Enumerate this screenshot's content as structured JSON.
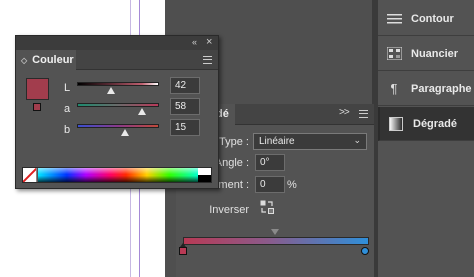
{
  "dock": {
    "items": [
      {
        "label": "Contour",
        "icon": "stroke-lines-icon"
      },
      {
        "label": "Nuancier",
        "icon": "swatches-grid-icon"
      },
      {
        "label": "Paragraphe",
        "icon": "pilcrow-icon",
        "glyph": "¶"
      },
      {
        "label": "Dégradé",
        "icon": "gradient-square-icon",
        "active": true
      }
    ]
  },
  "gradient_panel": {
    "tab_label_partial": "dé",
    "type_label": "Type :",
    "type_value": "Linéaire",
    "angle_label": "Angle :",
    "angle_value": "0°",
    "location_label_partial": "cement :",
    "location_value": "0",
    "location_unit": "%",
    "reverse_label": "Inverser",
    "start_color": "#b83a55",
    "end_color": "#2f8fd9"
  },
  "color_panel": {
    "title": "Couleur",
    "fill_color": "#a23d4d",
    "channels": [
      {
        "label": "L",
        "value": "42",
        "level": 0.42
      },
      {
        "label": "a",
        "value": "58",
        "level": 0.79
      },
      {
        "label": "b",
        "value": "15",
        "level": 0.58
      }
    ]
  }
}
